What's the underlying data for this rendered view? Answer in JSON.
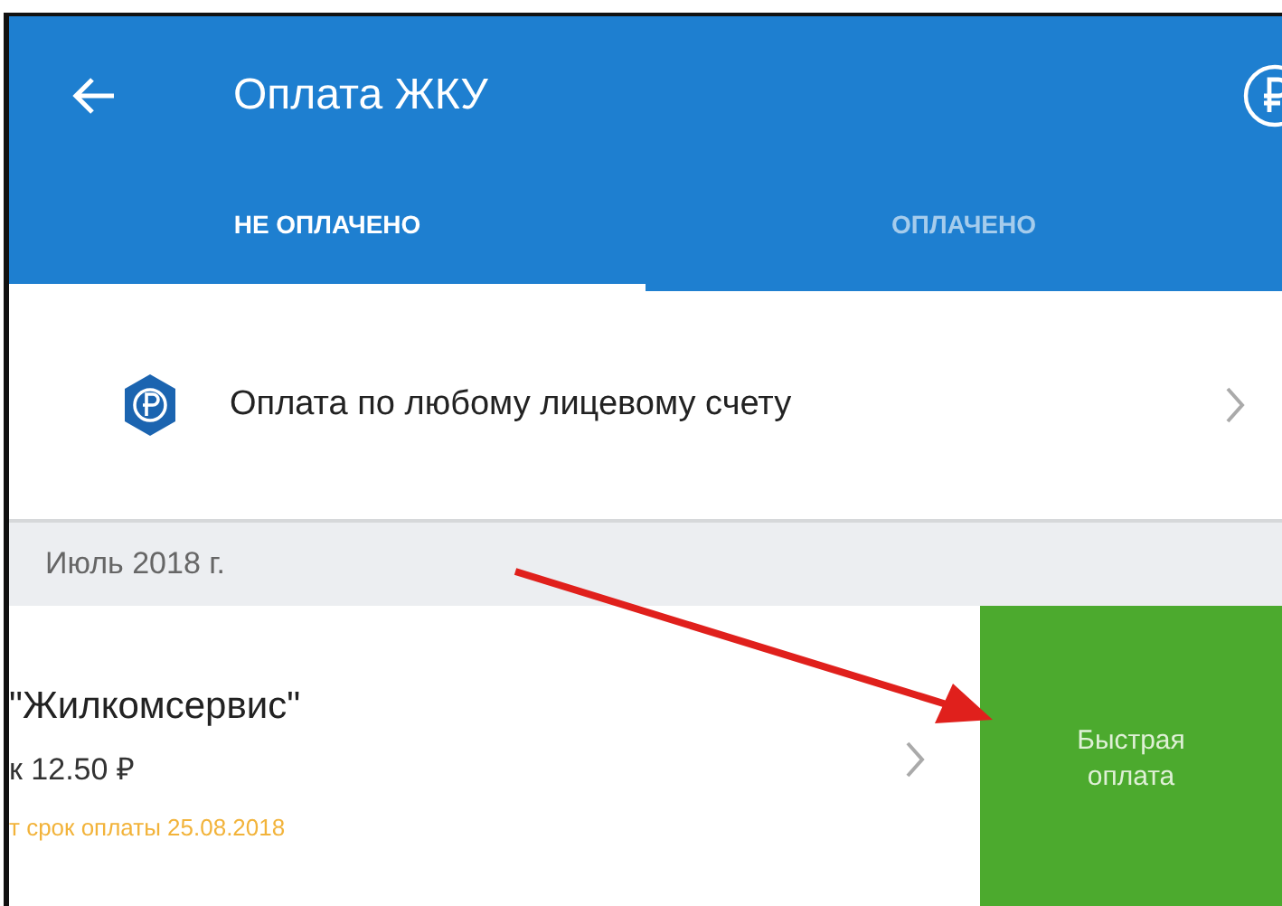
{
  "app_bar": {
    "title": "Оплата ЖКУ"
  },
  "tabs": [
    {
      "label": "НЕ ОПЛАЧЕНО",
      "selected": true
    },
    {
      "label": "ОПЛАЧЕНО",
      "selected": false
    }
  ],
  "any_account_row": {
    "label": "Оплата по любому лицевому счету"
  },
  "section": {
    "title": "Июль 2018 г."
  },
  "bill": {
    "provider": "\"Жилкомсервис\"",
    "amount": "к 12.50 ₽",
    "due": "т срок оплаты 25.08.2018"
  },
  "quick_pay": {
    "label": "Быстрая оплата"
  }
}
